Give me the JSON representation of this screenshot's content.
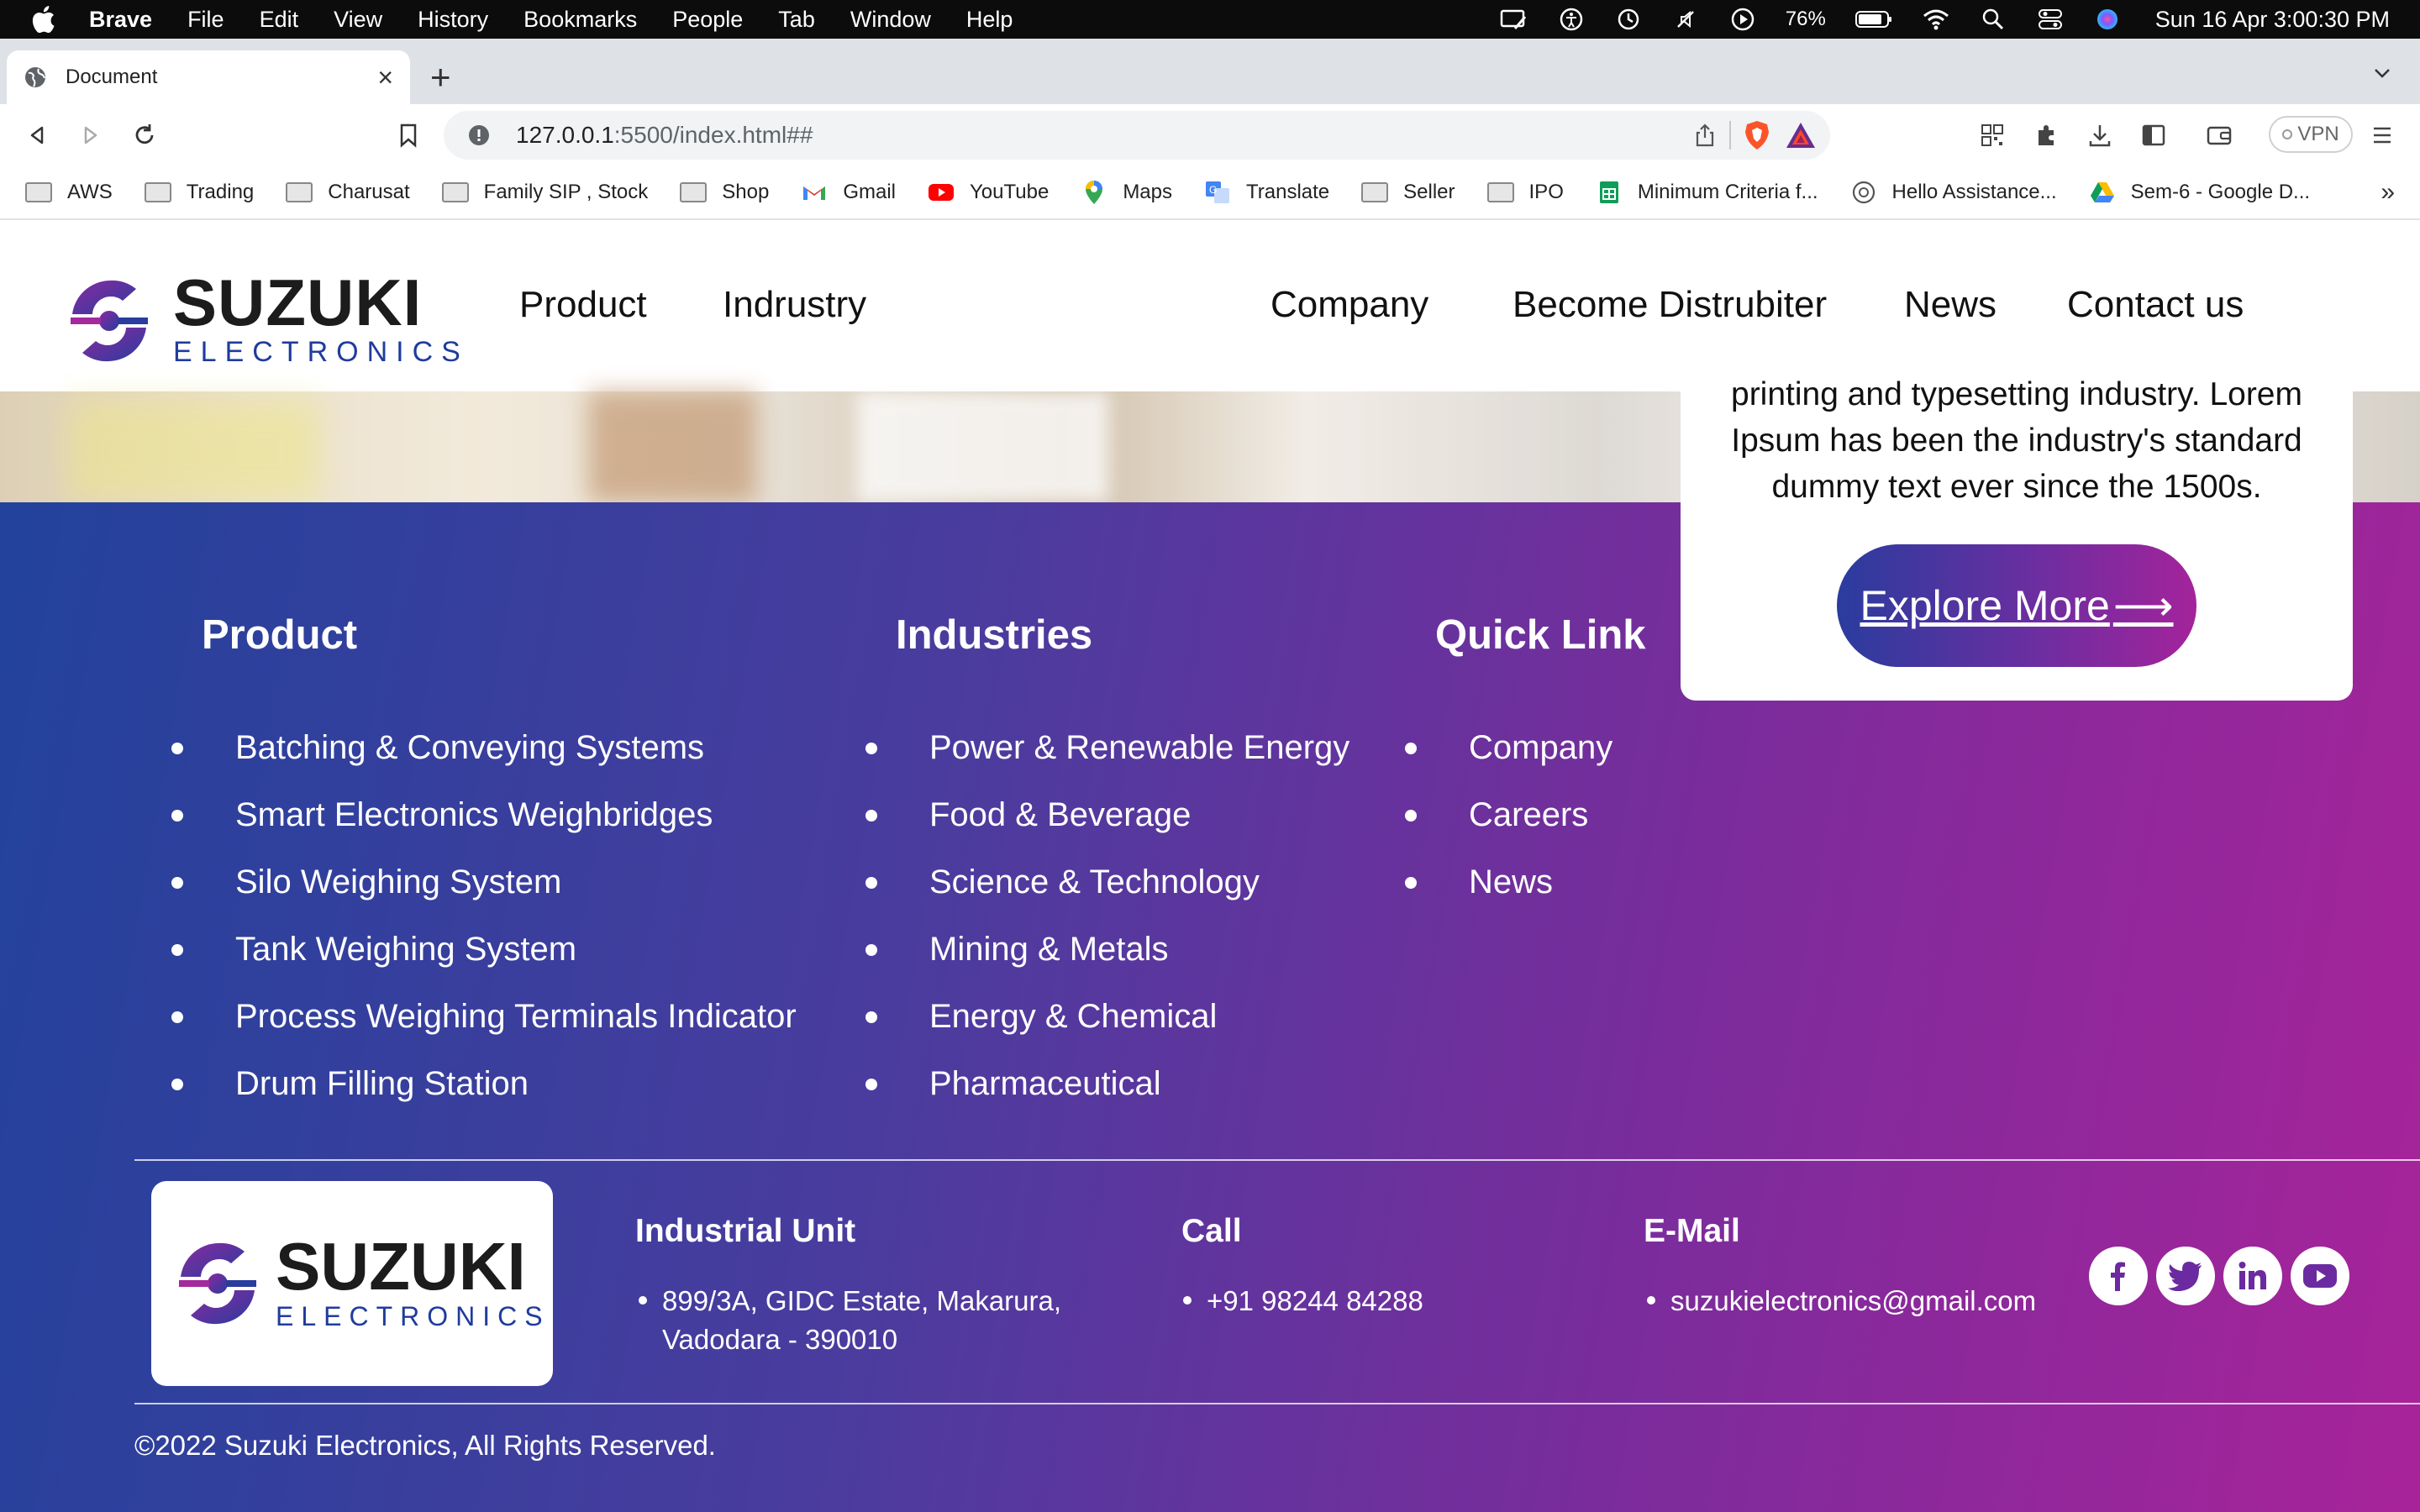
{
  "menubar": {
    "app": "Brave",
    "items": [
      "File",
      "Edit",
      "View",
      "History",
      "Bookmarks",
      "People",
      "Tab",
      "Window",
      "Help"
    ],
    "battery": "76%",
    "clock": "Sun 16 Apr  3:00:30 PM"
  },
  "browser": {
    "tab_title": "Document",
    "url_host": "127.0.0.1",
    "url_path": ":5500/index.html##",
    "vpn_label": "VPN",
    "bookmarks": [
      {
        "label": "AWS",
        "icon": "folder-icon"
      },
      {
        "label": "Trading",
        "icon": "folder-icon"
      },
      {
        "label": "Charusat",
        "icon": "folder-icon"
      },
      {
        "label": "Family SIP , Stock",
        "icon": "folder-icon"
      },
      {
        "label": "Shop",
        "icon": "folder-icon"
      },
      {
        "label": "Gmail",
        "icon": "gmail-icon"
      },
      {
        "label": "YouTube",
        "icon": "youtube-icon"
      },
      {
        "label": "Maps",
        "icon": "maps-icon"
      },
      {
        "label": "Translate",
        "icon": "translate-icon"
      },
      {
        "label": "Seller",
        "icon": "folder-icon"
      },
      {
        "label": "IPO",
        "icon": "folder-icon"
      },
      {
        "label": "Minimum Criteria f...",
        "icon": "sheets-icon"
      },
      {
        "label": "Hello Assistance...",
        "icon": "chatgpt-icon"
      },
      {
        "label": "Sem-6 - Google D...",
        "icon": "drive-icon"
      }
    ],
    "bookmarks_more": "»"
  },
  "site": {
    "logo": {
      "brand": "SUZUKI",
      "sub": "ELECTRONICS"
    },
    "nav": {
      "product": "Product",
      "industry": "Indrustry",
      "company": "Company",
      "distributor": "Become Distrubiter",
      "news": "News",
      "contact": "Contact us"
    },
    "card": {
      "text": "printing and typesetting industry. Lorem Ipsum has been the industry's standard dummy text ever since the 1500s.",
      "button": "Explore More",
      "arrow": "⟶"
    }
  },
  "footer": {
    "product": {
      "title": "Product",
      "items": [
        "Batching & Conveying Systems",
        "Smart Electronics Weighbridges",
        "Silo Weighing System",
        "Tank Weighing System",
        "Process Weighing Terminals Indicator",
        "Drum Filling Station"
      ]
    },
    "industries": {
      "title": "Industries",
      "items": [
        "Power & Renewable Energy",
        "Food & Beverage",
        "Science & Technology",
        "Mining & Metals",
        "Energy & Chemical",
        "Pharmaceutical"
      ]
    },
    "quick": {
      "title": "Quick Link",
      "items": [
        "Company",
        "Careers",
        "News"
      ]
    },
    "contact": {
      "unit_title": "Industrial Unit",
      "unit_line1": "899/3A, GIDC Estate, Makarura,",
      "unit_line2": "Vadodara - 390010",
      "call_title": "Call",
      "call_value": "+91 98244 84288",
      "email_title": "E-Mail",
      "email_value": "suzukielectronics@gmail.com"
    },
    "socials": [
      "facebook-icon",
      "twitter-icon",
      "linkedin-icon",
      "youtube-icon"
    ],
    "copyright": "©2022 Suzuki Electronics, All Rights Reserved."
  },
  "colors": {
    "footer_gradient_start": "#22429c",
    "footer_gradient_end": "#a8239a",
    "brand_blue": "#1f3c9c",
    "brand_purple": "#7b2ea0"
  }
}
